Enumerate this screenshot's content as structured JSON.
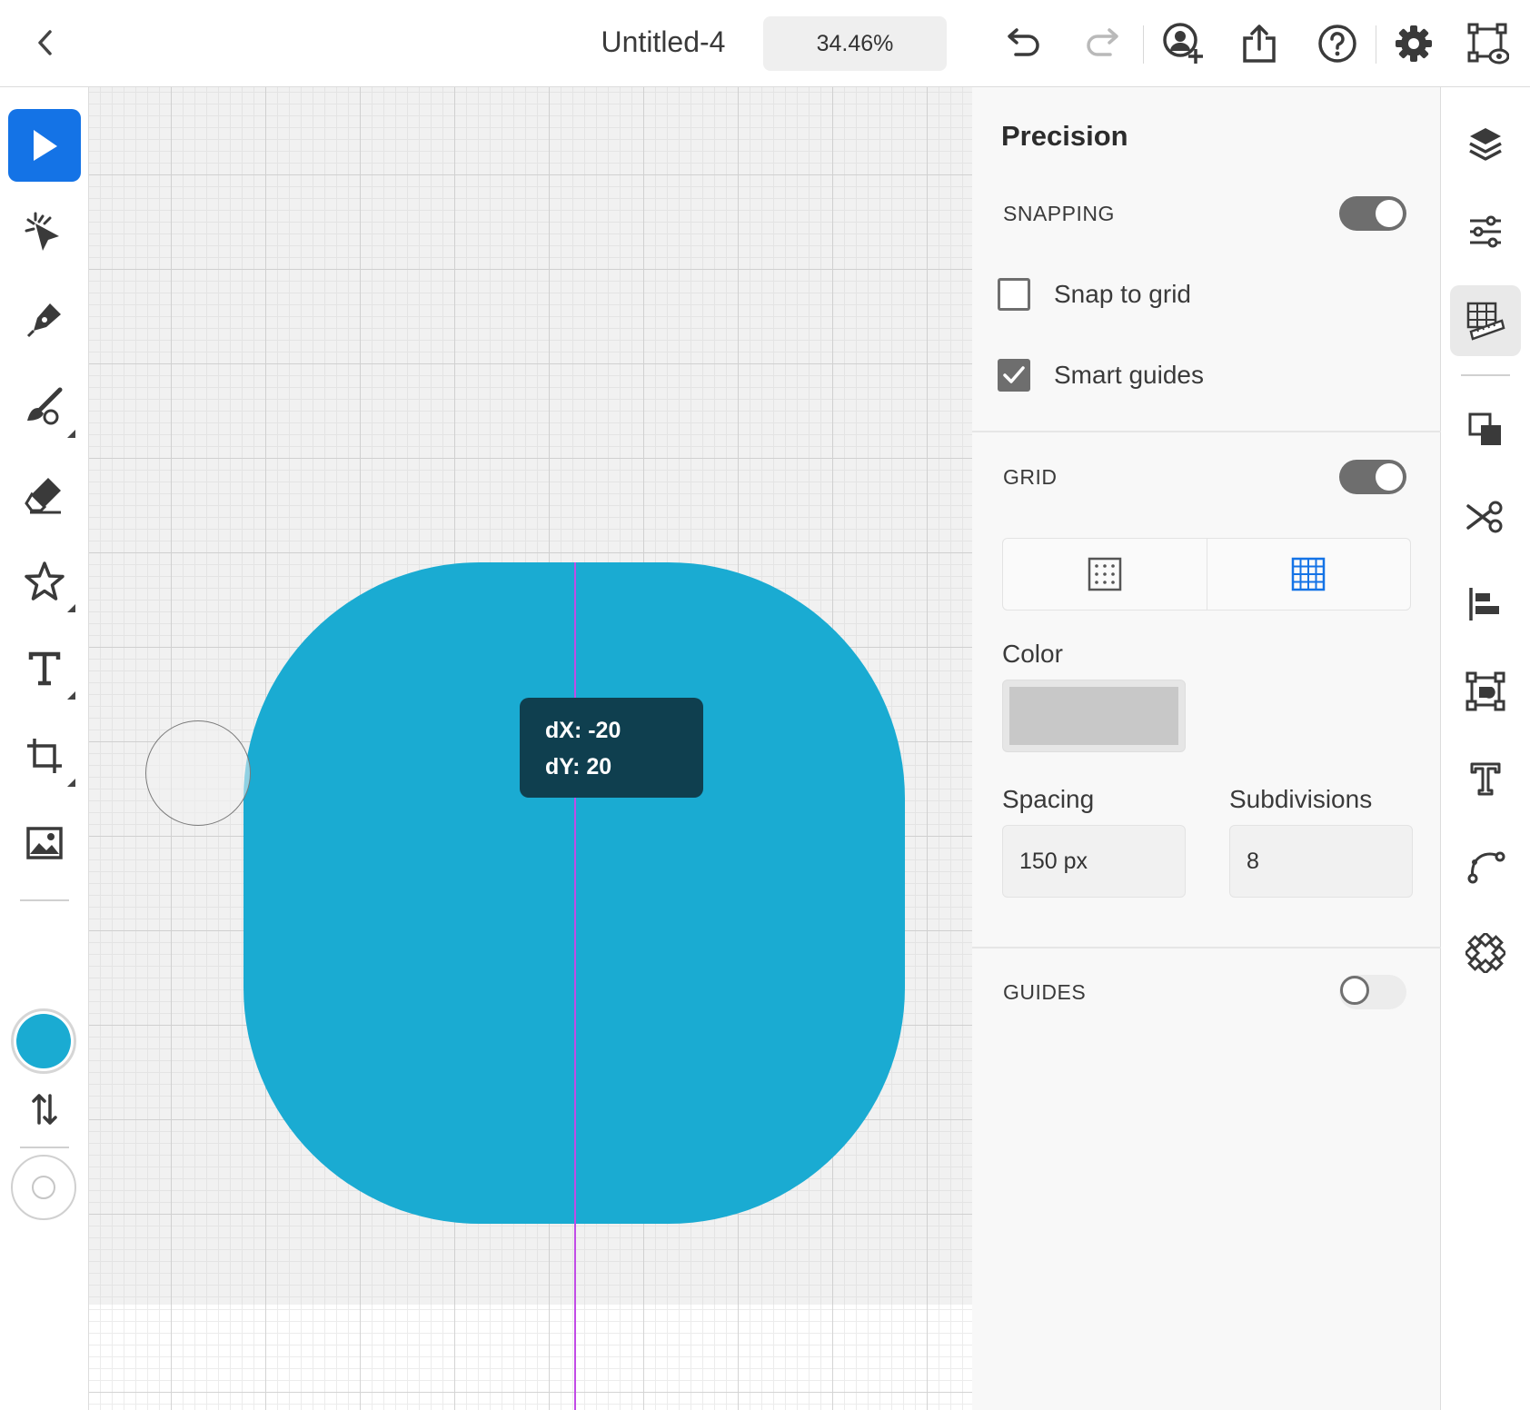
{
  "header": {
    "document_title": "Untitled-4",
    "zoom_level": "34.46%"
  },
  "canvas": {
    "shape_color": "#1aabd2",
    "guide_color": "#c24be6",
    "delta_tooltip": {
      "dx": "dX: -20",
      "dy": "dY: 20"
    }
  },
  "toolbar": {
    "active_tool": "selection",
    "fill_color": "#1aabd2",
    "accent_color": "#1473e6"
  },
  "panel": {
    "title": "Precision",
    "snapping": {
      "label": "SNAPPING",
      "enabled": true,
      "snap_to_grid_label": "Snap to grid",
      "snap_to_grid_checked": false,
      "smart_guides_label": "Smart guides",
      "smart_guides_checked": true
    },
    "grid": {
      "label": "GRID",
      "enabled": true,
      "selected_type": "square-grid",
      "color_label": "Color",
      "color_value": "#c8c8c8",
      "spacing_label": "Spacing",
      "spacing_value": "150 px",
      "subdivisions_label": "Subdivisions",
      "subdivisions_value": "8"
    },
    "guides": {
      "label": "GUIDES",
      "enabled": false
    }
  },
  "rail": {
    "active_item": "precision"
  }
}
